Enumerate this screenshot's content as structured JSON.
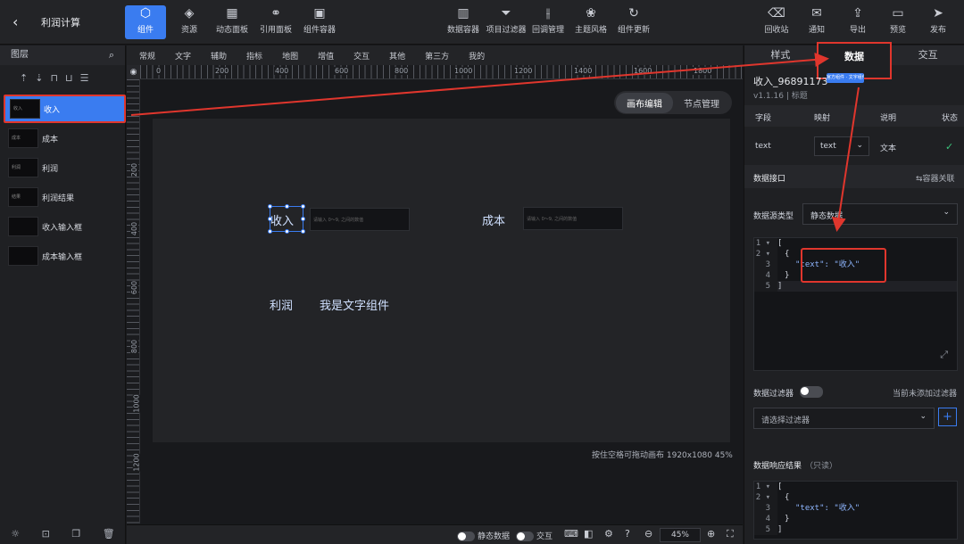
{
  "app": {
    "title": "利润计算"
  },
  "toolbar": {
    "left": [
      {
        "label": "组件",
        "icon": "component-icon",
        "active": true
      },
      {
        "label": "资源",
        "icon": "layers-icon"
      },
      {
        "label": "动态面板",
        "icon": "dashboard-icon"
      },
      {
        "label": "引用面板",
        "icon": "link-icon"
      },
      {
        "label": "组件容器",
        "icon": "container-icon"
      }
    ],
    "center": [
      {
        "label": "数据容器",
        "icon": "chart-icon"
      },
      {
        "label": "项目过滤器",
        "icon": "filter-icon"
      },
      {
        "label": "回调管理",
        "icon": "sliders-icon"
      },
      {
        "label": "主题风格",
        "icon": "palette-icon"
      },
      {
        "label": "组件更新",
        "icon": "refresh-icon"
      }
    ],
    "right": [
      {
        "label": "回收站",
        "icon": "trash-icon"
      },
      {
        "label": "通知",
        "icon": "message-icon"
      },
      {
        "label": "导出",
        "icon": "export-icon"
      },
      {
        "label": "预览",
        "icon": "preview-icon"
      },
      {
        "label": "发布",
        "icon": "send-icon"
      }
    ]
  },
  "layers_panel": {
    "title": "图层",
    "items": [
      {
        "label": "收入",
        "selected": true
      },
      {
        "label": "成本"
      },
      {
        "label": "利润"
      },
      {
        "label": "利润结果"
      },
      {
        "label": "收入输入框"
      },
      {
        "label": "成本输入框"
      }
    ]
  },
  "categories": [
    "常规",
    "文字",
    "辅助",
    "指标",
    "地图",
    "增值",
    "交互",
    "其他",
    "第三方",
    "我的"
  ],
  "ruler": {
    "h": [
      "0",
      "200",
      "400",
      "600",
      "800",
      "1000",
      "1200",
      "1400",
      "1600",
      "1800"
    ],
    "v": [
      "200",
      "400",
      "600",
      "800",
      "1000",
      "1200"
    ]
  },
  "mode": {
    "canvas_edit": "画布编辑",
    "node_manage": "节点管理"
  },
  "canvas": {
    "texts": {
      "income": "收入",
      "cost": "成本",
      "profit": "利润",
      "text_component": "我是文字组件"
    },
    "input_placeholder": "请输入 0～9, 之间的数值"
  },
  "canvas_hint": "按住空格可拖动画布  1920x1080 45%",
  "bottombar": {
    "static_data": "静态数据",
    "interaction": "交互",
    "zoom": "45%"
  },
  "right_panel": {
    "tabs": [
      "样式",
      "数据",
      "交互"
    ],
    "component_name": "收入_96891173",
    "badge": "官方组件 · 文字组件",
    "version": "v1.1.16 | 标题",
    "field_headers": [
      "字段",
      "映射",
      "说明",
      "状态"
    ],
    "field_row": {
      "field": "text",
      "mapping": "text",
      "desc": "文本",
      "status": "✓"
    },
    "data_interface": "数据接口",
    "container_link": "⇆容器关联",
    "datasource_label": "数据源类型",
    "datasource_value": "静态数据",
    "code_lines": [
      "[",
      "{",
      "\"text\": \"收入\"",
      "}",
      "]"
    ],
    "data_filter": "数据过滤器",
    "no_filter": "当前未添加过滤器",
    "filter_placeholder": "请选择过滤器",
    "response_title": "数据响应结果",
    "response_readonly": "（只读）",
    "response_lines": [
      "[",
      "{",
      "\"text\": \"收入\"",
      "}",
      "]"
    ]
  },
  "colors": {
    "accent": "#3a7cf0",
    "highlight": "#e0362d",
    "success": "#3cc47c"
  }
}
